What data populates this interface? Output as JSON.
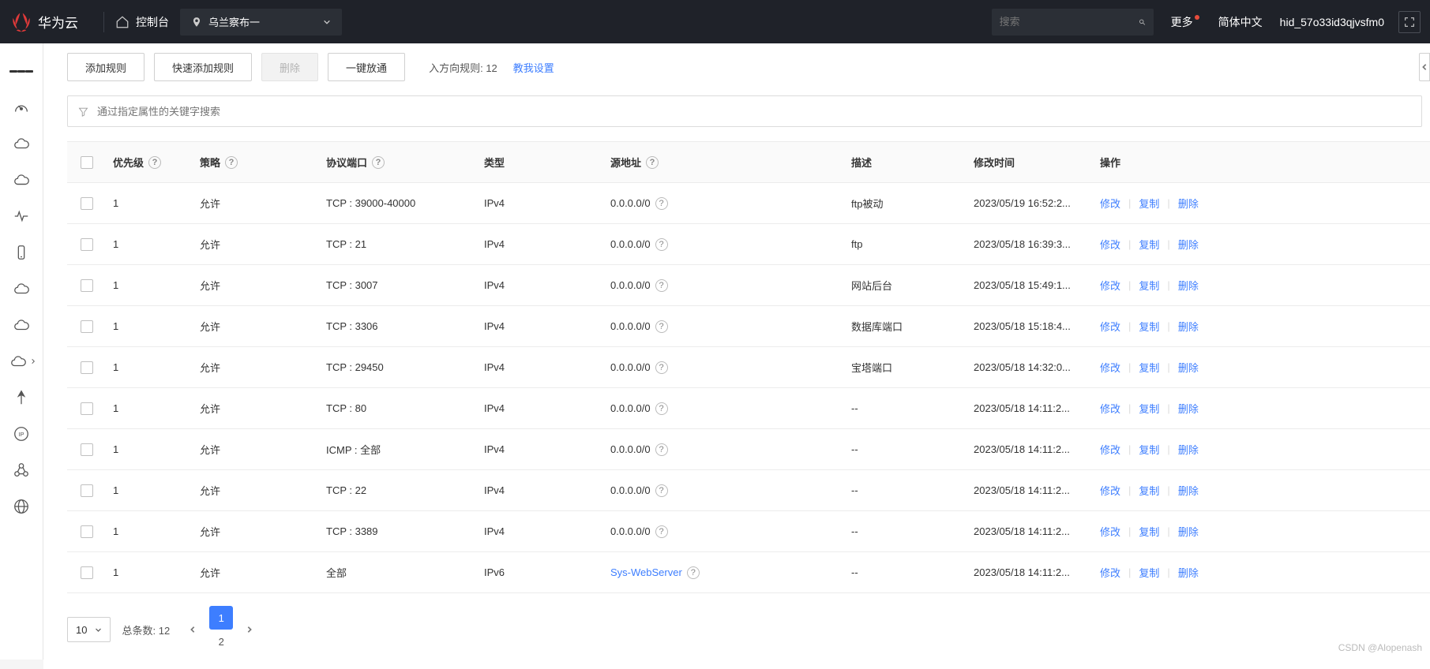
{
  "header": {
    "brand": "华为云",
    "console_label": "控制台",
    "region": "乌兰察布一",
    "search_placeholder": "搜索",
    "more_label": "更多",
    "lang_label": "简体中文",
    "user_id": "hid_57o33id3qjvsfm0"
  },
  "toolbar": {
    "add_rule": "添加规则",
    "quick_add": "快速添加规则",
    "delete": "删除",
    "one_click": "一键放通",
    "inbound_label": "入方向规则:",
    "inbound_count": "12",
    "teach_me": "教我设置"
  },
  "filter": {
    "placeholder": "通过指定属性的关键字搜索"
  },
  "table": {
    "headers": {
      "priority": "优先级",
      "policy": "策略",
      "port": "协议端口",
      "type": "类型",
      "source": "源地址",
      "desc": "描述",
      "mtime": "修改时间",
      "ops": "操作"
    },
    "ops": {
      "modify": "修改",
      "copy": "复制",
      "delete": "删除"
    },
    "rows": [
      {
        "priority": "1",
        "policy": "允许",
        "port": "TCP : 39000-40000",
        "type": "IPv4",
        "source": "0.0.0.0/0",
        "source_link": false,
        "desc": "ftp被动",
        "mtime": "2023/05/19 16:52:2..."
      },
      {
        "priority": "1",
        "policy": "允许",
        "port": "TCP : 21",
        "type": "IPv4",
        "source": "0.0.0.0/0",
        "source_link": false,
        "desc": "ftp",
        "mtime": "2023/05/18 16:39:3..."
      },
      {
        "priority": "1",
        "policy": "允许",
        "port": "TCP : 3007",
        "type": "IPv4",
        "source": "0.0.0.0/0",
        "source_link": false,
        "desc": "网站后台",
        "mtime": "2023/05/18 15:49:1..."
      },
      {
        "priority": "1",
        "policy": "允许",
        "port": "TCP : 3306",
        "type": "IPv4",
        "source": "0.0.0.0/0",
        "source_link": false,
        "desc": "数据库端口",
        "mtime": "2023/05/18 15:18:4..."
      },
      {
        "priority": "1",
        "policy": "允许",
        "port": "TCP : 29450",
        "type": "IPv4",
        "source": "0.0.0.0/0",
        "source_link": false,
        "desc": "宝塔端口",
        "mtime": "2023/05/18 14:32:0..."
      },
      {
        "priority": "1",
        "policy": "允许",
        "port": "TCP : 80",
        "type": "IPv4",
        "source": "0.0.0.0/0",
        "source_link": false,
        "desc": "--",
        "mtime": "2023/05/18 14:11:2..."
      },
      {
        "priority": "1",
        "policy": "允许",
        "port": "ICMP : 全部",
        "type": "IPv4",
        "source": "0.0.0.0/0",
        "source_link": false,
        "desc": "--",
        "mtime": "2023/05/18 14:11:2..."
      },
      {
        "priority": "1",
        "policy": "允许",
        "port": "TCP : 22",
        "type": "IPv4",
        "source": "0.0.0.0/0",
        "source_link": false,
        "desc": "--",
        "mtime": "2023/05/18 14:11:2..."
      },
      {
        "priority": "1",
        "policy": "允许",
        "port": "TCP : 3389",
        "type": "IPv4",
        "source": "0.0.0.0/0",
        "source_link": false,
        "desc": "--",
        "mtime": "2023/05/18 14:11:2..."
      },
      {
        "priority": "1",
        "policy": "允许",
        "port": "全部",
        "type": "IPv6",
        "source": "Sys-WebServer",
        "source_link": true,
        "desc": "--",
        "mtime": "2023/05/18 14:11:2..."
      }
    ]
  },
  "pager": {
    "page_size": "10",
    "total_label": "总条数:",
    "total": "12",
    "current": "1",
    "pages": [
      "1",
      "2"
    ]
  },
  "watermark": "CSDN @Alopenash"
}
